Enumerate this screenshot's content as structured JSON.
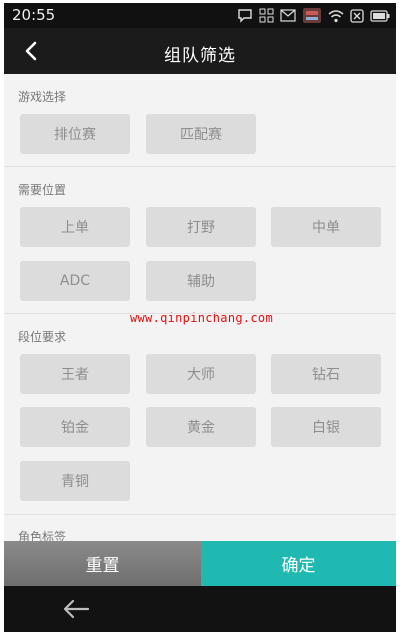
{
  "status_bar": {
    "time": "20:55"
  },
  "header": {
    "title": "组队筛选"
  },
  "sections": {
    "game": {
      "title": "游戏选择",
      "options": [
        "排位赛",
        "匹配赛"
      ]
    },
    "position": {
      "title": "需要位置",
      "options": [
        "上单",
        "打野",
        "中单",
        "ADC",
        "辅助"
      ]
    },
    "rank": {
      "title": "段位要求",
      "options": [
        "王者",
        "大师",
        "钻石",
        "铂金",
        "黄金",
        "白银",
        "青铜"
      ]
    },
    "role": {
      "title": "角色标签"
    }
  },
  "watermark": "www.qinpinchang.com",
  "footer": {
    "reset_label": "重置",
    "confirm_label": "确定"
  },
  "colors": {
    "accent": "#1fb9b1",
    "title_bar": "#1b1b1b",
    "chip_bg": "#dcdcdc",
    "chip_text": "#8e8e8e",
    "watermark": "#e01111"
  }
}
